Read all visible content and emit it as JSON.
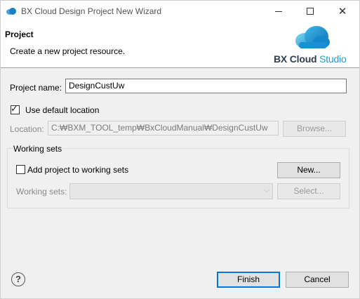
{
  "window": {
    "title": "BX Cloud Design Project New Wizard",
    "minimize_icon": "minimize-icon",
    "maximize_icon": "maximize-icon",
    "close_icon": "close-icon",
    "close_glyph": "✕"
  },
  "banner": {
    "title": "Project",
    "description": "Create a new project resource.",
    "logo": {
      "brand": "BX Cloud",
      "product": "Studio"
    }
  },
  "form": {
    "project_name_label": "Project name:",
    "project_name_value": "DesignCustUw",
    "use_default_location_label": "Use default location",
    "use_default_location_checked": true,
    "location_label": "Location:",
    "location_value": "C:₩BXM_TOOL_temp₩BxCloudManual₩DesignCustUw",
    "browse_label": "Browse..."
  },
  "working_sets": {
    "group_label": "Working sets",
    "add_to_working_sets_label": "Add project to working sets",
    "add_to_working_sets_checked": false,
    "new_label": "New...",
    "working_sets_label": "Working sets:",
    "working_sets_value": "",
    "select_label": "Select..."
  },
  "footer": {
    "help_glyph": "?",
    "finish_label": "Finish",
    "cancel_label": "Cancel"
  },
  "colors": {
    "logo_blue": "#1f9ad6",
    "logo_dark": "#2c3e50",
    "focus_border": "#0078d7"
  }
}
